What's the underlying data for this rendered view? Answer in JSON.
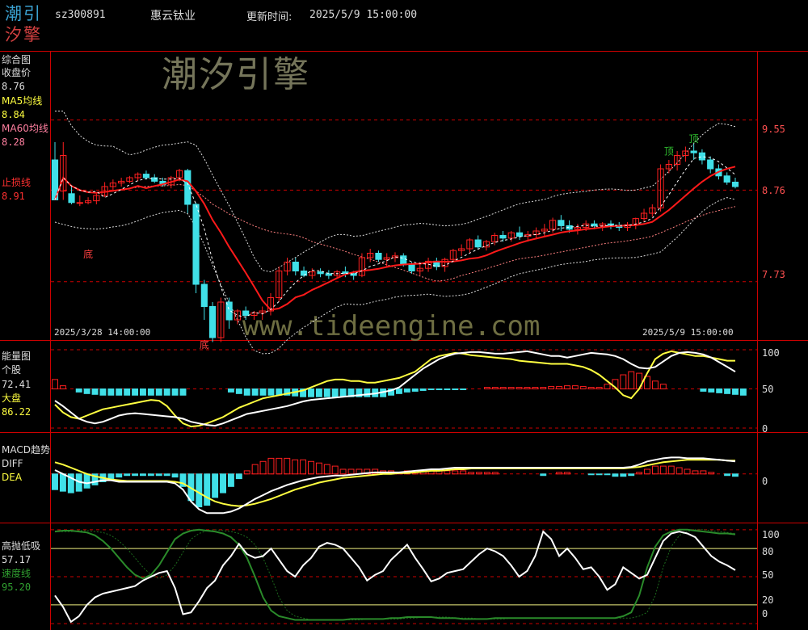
{
  "header": {
    "logo_line1": "潮引",
    "logo_line2": "汐擎",
    "code": "sz300891",
    "name": "惠云钛业",
    "update_label": "更新时间:",
    "update_time": "2025/5/9 15:00:00"
  },
  "watermark": {
    "brand": "潮汐引擎",
    "url": "www.tideengine.com"
  },
  "colors": {
    "up": "#ff2020",
    "down": "#40e0e8",
    "ma5": "#ffff40",
    "ma60": "#ff8080",
    "stop": "#ff3030",
    "white": "#ffffff",
    "green": "#2a8a2a",
    "grid": "#cc0000"
  },
  "chart_data": [
    {
      "type": "candlestick",
      "panel": "综合图",
      "legend": [
        {
          "name": "收盘价",
          "value": "8.76"
        },
        {
          "name": "MA5均线",
          "value": "8.84"
        },
        {
          "name": "MA60均线",
          "value": "8.28"
        },
        {
          "name": "止损线",
          "value": "8.91"
        }
      ],
      "y_ticks": [
        "9.55",
        "8.76",
        "7.73"
      ],
      "ylim": [
        7.1,
        10.3
      ],
      "x_start_label": "2025/3/28 14:00:00",
      "x_end_label": "2025/5/9 15:00:00",
      "annotations": [
        {
          "text": "底",
          "i": 4,
          "price": 8.0
        },
        {
          "text": "底",
          "i": 18,
          "price": 6.98
        },
        {
          "text": "顶",
          "i": 74,
          "price": 9.16
        },
        {
          "text": "顶",
          "i": 77,
          "price": 9.3
        }
      ],
      "ohlc": [
        [
          9.1,
          9.3,
          8.7,
          8.65
        ],
        [
          8.75,
          9.3,
          8.65,
          9.15
        ],
        [
          8.72,
          8.8,
          8.6,
          8.62
        ],
        [
          8.62,
          8.7,
          8.58,
          8.62
        ],
        [
          8.62,
          8.68,
          8.6,
          8.64
        ],
        [
          8.64,
          8.72,
          8.6,
          8.7
        ],
        [
          8.7,
          8.85,
          8.68,
          8.8
        ],
        [
          8.8,
          8.88,
          8.76,
          8.84
        ],
        [
          8.84,
          8.9,
          8.8,
          8.86
        ],
        [
          8.86,
          8.92,
          8.84,
          8.9
        ],
        [
          8.9,
          8.96,
          8.86,
          8.94
        ],
        [
          8.94,
          8.98,
          8.88,
          8.9
        ],
        [
          8.9,
          8.94,
          8.84,
          8.86
        ],
        [
          8.86,
          8.9,
          8.8,
          8.82
        ],
        [
          8.82,
          8.92,
          8.78,
          8.9
        ],
        [
          8.9,
          9.0,
          8.86,
          8.98
        ],
        [
          8.98,
          9.0,
          8.5,
          8.6
        ],
        [
          8.6,
          8.62,
          7.6,
          7.7
        ],
        [
          7.7,
          7.75,
          7.3,
          7.45
        ],
        [
          7.45,
          7.5,
          7.05,
          7.1
        ],
        [
          7.1,
          7.55,
          7.05,
          7.5
        ],
        [
          7.5,
          7.55,
          7.2,
          7.3
        ],
        [
          7.3,
          7.42,
          7.25,
          7.4
        ],
        [
          7.4,
          7.45,
          7.3,
          7.35
        ],
        [
          7.35,
          7.4,
          7.3,
          7.38
        ],
        [
          7.38,
          7.45,
          7.3,
          7.4
        ],
        [
          7.4,
          7.6,
          7.35,
          7.55
        ],
        [
          7.55,
          7.9,
          7.5,
          7.85
        ],
        [
          7.85,
          8.0,
          7.8,
          7.95
        ],
        [
          7.95,
          8.0,
          7.8,
          7.85
        ],
        [
          7.85,
          7.9,
          7.78,
          7.8
        ],
        [
          7.8,
          7.88,
          7.76,
          7.84
        ],
        [
          7.84,
          7.88,
          7.78,
          7.82
        ],
        [
          7.82,
          7.86,
          7.76,
          7.8
        ],
        [
          7.8,
          7.86,
          7.78,
          7.84
        ],
        [
          7.84,
          7.9,
          7.78,
          7.82
        ],
        [
          7.82,
          7.85,
          7.75,
          7.8
        ],
        [
          7.8,
          8.05,
          7.78,
          8.0
        ],
        [
          8.0,
          8.1,
          7.95,
          8.05
        ],
        [
          8.05,
          8.08,
          7.95,
          7.98
        ],
        [
          7.98,
          8.05,
          7.9,
          8.0
        ],
        [
          8.0,
          8.06,
          7.95,
          8.02
        ],
        [
          8.02,
          8.05,
          7.9,
          7.92
        ],
        [
          7.92,
          7.95,
          7.82,
          7.85
        ],
        [
          7.85,
          7.95,
          7.8,
          7.88
        ],
        [
          7.88,
          8.0,
          7.84,
          7.96
        ],
        [
          7.96,
          8.0,
          7.86,
          7.9
        ],
        [
          7.9,
          8.0,
          7.84,
          7.98
        ],
        [
          7.98,
          8.1,
          7.95,
          8.08
        ],
        [
          8.08,
          8.15,
          8.02,
          8.1
        ],
        [
          8.1,
          8.22,
          8.05,
          8.2
        ],
        [
          8.2,
          8.25,
          8.1,
          8.12
        ],
        [
          8.12,
          8.2,
          8.08,
          8.18
        ],
        [
          8.18,
          8.28,
          8.14,
          8.25
        ],
        [
          8.25,
          8.3,
          8.18,
          8.22
        ],
        [
          8.22,
          8.3,
          8.18,
          8.28
        ],
        [
          8.28,
          8.35,
          8.2,
          8.24
        ],
        [
          8.24,
          8.3,
          8.18,
          8.26
        ],
        [
          8.26,
          8.34,
          8.22,
          8.3
        ],
        [
          8.3,
          8.38,
          8.24,
          8.32
        ],
        [
          8.32,
          8.45,
          8.28,
          8.42
        ],
        [
          8.42,
          8.48,
          8.3,
          8.36
        ],
        [
          8.36,
          8.42,
          8.28,
          8.32
        ],
        [
          8.32,
          8.38,
          8.26,
          8.34
        ],
        [
          8.34,
          8.42,
          8.3,
          8.38
        ],
        [
          8.38,
          8.42,
          8.32,
          8.36
        ],
        [
          8.36,
          8.4,
          8.3,
          8.38
        ],
        [
          8.38,
          8.42,
          8.32,
          8.36
        ],
        [
          8.36,
          8.4,
          8.3,
          8.34
        ],
        [
          8.34,
          8.4,
          8.3,
          8.37
        ],
        [
          8.37,
          8.45,
          8.32,
          8.44
        ],
        [
          8.44,
          8.55,
          8.4,
          8.5
        ],
        [
          8.5,
          8.6,
          8.46,
          8.56
        ],
        [
          8.56,
          9.05,
          8.52,
          9.0
        ],
        [
          9.0,
          9.1,
          8.95,
          9.05
        ],
        [
          9.05,
          9.2,
          8.98,
          9.15
        ],
        [
          9.15,
          9.25,
          9.08,
          9.2
        ],
        [
          9.2,
          9.28,
          9.1,
          9.18
        ],
        [
          9.18,
          9.22,
          9.05,
          9.1
        ],
        [
          9.1,
          9.14,
          8.95,
          9.0
        ],
        [
          9.0,
          9.05,
          8.88,
          8.92
        ],
        [
          8.92,
          8.96,
          8.82,
          8.85
        ],
        [
          8.85,
          8.9,
          8.78,
          8.8
        ]
      ]
    },
    {
      "type": "line+bar",
      "panel": "能量图",
      "legend": [
        {
          "name": "个股",
          "value": "72.41"
        },
        {
          "name": "大盘",
          "value": "86.22"
        }
      ],
      "y_ticks": [
        "100",
        "50",
        "0"
      ],
      "ylim": [
        0,
        100
      ],
      "series_个股": [
        35,
        28,
        20,
        12,
        8,
        6,
        8,
        12,
        16,
        18,
        19,
        18,
        17,
        16,
        15,
        14,
        12,
        8,
        6,
        4,
        3,
        6,
        10,
        14,
        18,
        20,
        22,
        24,
        26,
        28,
        31,
        34,
        36,
        37,
        38,
        39,
        40,
        41,
        42,
        43,
        44,
        46,
        48,
        52,
        60,
        68,
        76,
        82,
        88,
        92,
        95,
        96,
        97,
        97,
        96,
        95,
        95,
        96,
        97,
        98,
        96,
        94,
        92,
        92,
        90,
        92,
        94,
        96,
        95,
        94,
        92,
        88,
        82,
        77,
        76,
        78,
        85,
        92,
        96,
        97,
        96,
        94,
        90,
        84,
        78,
        72
      ],
      "series_大盘": [
        30,
        20,
        14,
        12,
        16,
        20,
        24,
        26,
        28,
        30,
        32,
        34,
        36,
        35,
        28,
        16,
        6,
        2,
        3,
        6,
        10,
        14,
        20,
        26,
        30,
        34,
        38,
        40,
        42,
        44,
        46,
        48,
        52,
        56,
        60,
        62,
        62,
        60,
        60,
        58,
        58,
        60,
        62,
        64,
        68,
        72,
        80,
        88,
        92,
        94,
        96,
        95,
        93,
        92,
        91,
        90,
        89,
        88,
        86,
        85,
        84,
        83,
        82,
        82,
        82,
        80,
        78,
        74,
        68,
        60,
        52,
        42,
        38,
        50,
        70,
        88,
        95,
        98,
        96,
        94,
        92,
        92,
        90,
        88,
        86,
        86
      ],
      "bars": [
        12,
        4,
        0,
        -4,
        -6,
        -7,
        -8,
        -8,
        -8,
        -8,
        -8,
        -8,
        -8,
        -8,
        -8,
        -8,
        -8,
        0,
        0,
        0,
        0,
        0,
        -4,
        -6,
        -8,
        -8,
        -8,
        -8,
        -8,
        -8,
        -9,
        -10,
        -10,
        -10,
        -10,
        -10,
        -10,
        -10,
        -10,
        -10,
        -10,
        -10,
        -8,
        -6,
        -4,
        -3,
        -2,
        -1,
        -1,
        -1,
        -1,
        -1,
        0,
        0,
        2,
        2,
        2,
        2,
        2,
        2,
        2,
        2,
        3,
        3,
        4,
        4,
        3,
        2,
        2,
        6,
        12,
        18,
        22,
        20,
        16,
        10,
        6,
        0,
        0,
        0,
        0,
        -3,
        -4,
        -5,
        -6,
        -7,
        -8
      ]
    },
    {
      "type": "line+bar",
      "panel": "MACD趋势",
      "legend": [
        {
          "name": "DIFF",
          "value": ""
        },
        {
          "name": "DEA",
          "value": ""
        }
      ],
      "y_ticks": [
        "0"
      ],
      "ylim": [
        -0.6,
        0.4
      ],
      "series_DIFF": [
        0.05,
        0.0,
        -0.05,
        -0.1,
        -0.12,
        -0.1,
        -0.08,
        -0.08,
        -0.1,
        -0.1,
        -0.1,
        -0.1,
        -0.1,
        -0.1,
        -0.1,
        -0.12,
        -0.2,
        -0.35,
        -0.45,
        -0.5,
        -0.5,
        -0.5,
        -0.48,
        -0.44,
        -0.38,
        -0.32,
        -0.27,
        -0.22,
        -0.18,
        -0.14,
        -0.11,
        -0.08,
        -0.06,
        -0.04,
        -0.03,
        -0.02,
        -0.02,
        -0.01,
        0.0,
        0.01,
        0.02,
        0.02,
        0.02,
        0.02,
        0.03,
        0.04,
        0.05,
        0.06,
        0.06,
        0.07,
        0.08,
        0.08,
        0.08,
        0.08,
        0.08,
        0.08,
        0.08,
        0.08,
        0.08,
        0.08,
        0.08,
        0.08,
        0.08,
        0.08,
        0.08,
        0.08,
        0.08,
        0.08,
        0.08,
        0.08,
        0.08,
        0.08,
        0.09,
        0.12,
        0.16,
        0.18,
        0.2,
        0.21,
        0.21,
        0.2,
        0.2,
        0.2,
        0.19,
        0.18,
        0.17,
        0.16
      ],
      "series_DEA": [
        0.15,
        0.12,
        0.08,
        0.04,
        0.0,
        -0.03,
        -0.05,
        -0.07,
        -0.08,
        -0.09,
        -0.09,
        -0.09,
        -0.09,
        -0.09,
        -0.09,
        -0.1,
        -0.12,
        -0.18,
        -0.24,
        -0.3,
        -0.35,
        -0.38,
        -0.4,
        -0.41,
        -0.4,
        -0.38,
        -0.35,
        -0.32,
        -0.28,
        -0.24,
        -0.2,
        -0.17,
        -0.14,
        -0.11,
        -0.09,
        -0.07,
        -0.05,
        -0.04,
        -0.03,
        -0.02,
        -0.01,
        0.0,
        0.0,
        0.01,
        0.01,
        0.02,
        0.03,
        0.04,
        0.04,
        0.05,
        0.06,
        0.06,
        0.07,
        0.07,
        0.07,
        0.07,
        0.07,
        0.07,
        0.07,
        0.07,
        0.07,
        0.07,
        0.07,
        0.07,
        0.07,
        0.07,
        0.07,
        0.07,
        0.07,
        0.07,
        0.07,
        0.07,
        0.08,
        0.09,
        0.11,
        0.13,
        0.15,
        0.16,
        0.17,
        0.18,
        0.18,
        0.18,
        0.18,
        0.18,
        0.17,
        0.17
      ],
      "bars": [
        -0.2,
        -0.22,
        -0.24,
        -0.22,
        -0.18,
        -0.14,
        -0.1,
        -0.06,
        -0.04,
        -0.02,
        -0.02,
        -0.02,
        -0.02,
        -0.02,
        -0.02,
        -0.04,
        -0.16,
        -0.34,
        -0.42,
        -0.4,
        -0.3,
        -0.24,
        -0.16,
        -0.06,
        0.04,
        0.12,
        0.16,
        0.2,
        0.2,
        0.2,
        0.18,
        0.18,
        0.16,
        0.14,
        0.12,
        0.1,
        0.06,
        0.06,
        0.06,
        0.06,
        0.06,
        0.04,
        0.04,
        0.02,
        0.04,
        0.04,
        0.04,
        0.04,
        0.04,
        0.04,
        0.04,
        0.04,
        0.02,
        0.02,
        0.02,
        0.02,
        0.0,
        0.0,
        0.0,
        0.0,
        0.0,
        -0.02,
        0.0,
        0.02,
        0.02,
        0.0,
        0.0,
        -0.01,
        -0.01,
        -0.01,
        -0.03,
        -0.03,
        -0.02,
        0.02,
        0.06,
        0.1,
        0.1,
        0.1,
        0.08,
        0.06,
        0.04,
        0.04,
        0.02,
        0.0,
        -0.02,
        -0.03
      ]
    },
    {
      "type": "line",
      "panel": "高抛低吸",
      "legend": [
        {
          "name": "",
          "value": "57.17"
        },
        {
          "name": "速度线",
          "value": "95.20"
        }
      ],
      "y_ticks": [
        "100",
        "80",
        "50",
        "20",
        "0"
      ],
      "ylim": [
        -5,
        105
      ],
      "series_white": [
        30,
        18,
        2,
        8,
        20,
        28,
        32,
        34,
        36,
        38,
        40,
        46,
        50,
        54,
        56,
        38,
        10,
        12,
        24,
        38,
        46,
        62,
        72,
        85,
        74,
        70,
        72,
        80,
        68,
        56,
        50,
        62,
        70,
        82,
        86,
        84,
        80,
        70,
        60,
        46,
        52,
        56,
        68,
        76,
        84,
        70,
        58,
        45,
        48,
        54,
        56,
        58,
        66,
        74,
        80,
        77,
        72,
        62,
        50,
        56,
        72,
        98,
        90,
        72,
        80,
        70,
        58,
        60,
        50,
        36,
        42,
        60,
        54,
        48,
        52,
        70,
        88,
        96,
        98,
        96,
        92,
        82,
        72,
        66,
        62,
        57
      ],
      "series_green": [
        98,
        99,
        99,
        98,
        97,
        94,
        88,
        80,
        70,
        60,
        52,
        48,
        52,
        62,
        76,
        90,
        96,
        99,
        100,
        99,
        98,
        96,
        92,
        84,
        70,
        50,
        28,
        14,
        8,
        6,
        4,
        4,
        4,
        4,
        4,
        4,
        4,
        5,
        5,
        5,
        5,
        5,
        6,
        6,
        7,
        7,
        7,
        7,
        6,
        6,
        6,
        5,
        5,
        5,
        5,
        6,
        6,
        6,
        6,
        6,
        6,
        6,
        6,
        6,
        6,
        6,
        6,
        6,
        6,
        6,
        6,
        8,
        12,
        30,
        60,
        82,
        94,
        98,
        100,
        100,
        99,
        98,
        97,
        96,
        96,
        95
      ]
    }
  ]
}
